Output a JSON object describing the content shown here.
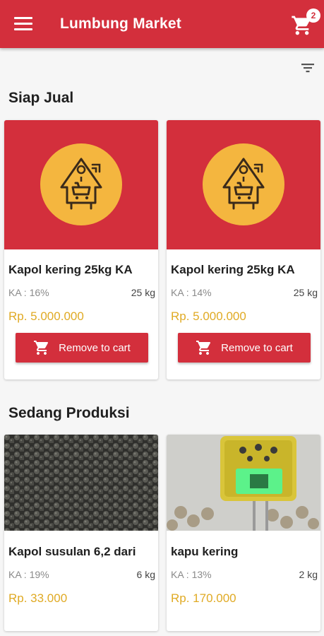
{
  "appbar": {
    "title": "Lumbung Market",
    "cart_count": "2",
    "menu_icon": "menu-icon",
    "cart_icon": "cart-icon",
    "filter_icon": "filter-icon",
    "brand_color": "#d32f3c"
  },
  "sections": {
    "ready": {
      "title": "Siap Jual",
      "items": [
        {
          "name": "Kapol kering 25kg KA",
          "ka": "KA : 16%",
          "weight": "25 kg",
          "price": "Rp. 5.000.000",
          "button": "Remove to cart"
        },
        {
          "name": "Kapol kering 25kg KA",
          "ka": "KA : 14%",
          "weight": "25 kg",
          "price": "Rp. 5.000.000",
          "button": "Remove to cart"
        }
      ]
    },
    "production": {
      "title": "Sedang Produksi",
      "items": [
        {
          "name": "Kapol susulan 6,2 dari",
          "ka": "KA : 19%",
          "weight": "6 kg",
          "price": "Rp. 33.000"
        },
        {
          "name": "kapu kering",
          "ka": "KA : 13%",
          "weight": "2 kg",
          "price": "Rp. 170.000"
        }
      ]
    }
  },
  "colors": {
    "price": "#e0aa24",
    "logo_circle": "#f4b63f"
  }
}
